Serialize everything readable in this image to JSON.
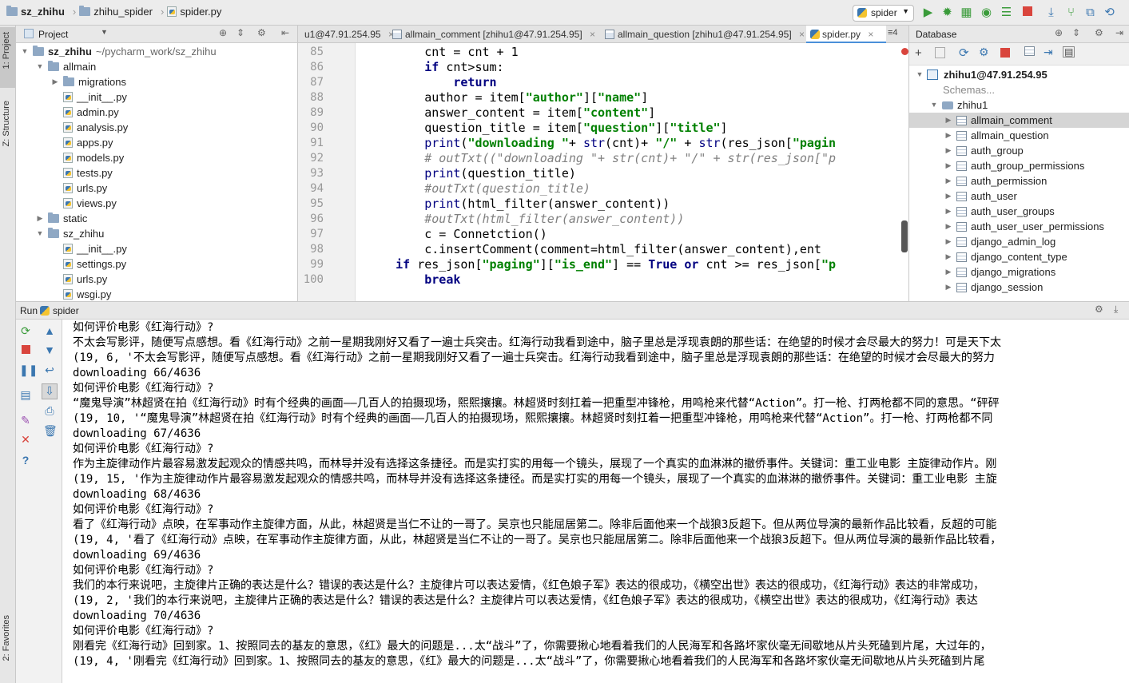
{
  "breadcrumb": [
    "sz_zhihu",
    "zhihu_spider",
    "spider.py"
  ],
  "run_config": "spider",
  "project_panel": {
    "title": "Project",
    "tree": [
      {
        "label": "sz_zhihu",
        "extra": "~/pycharm_work/sz_zhihu",
        "depth": 0,
        "type": "folder",
        "open": true
      },
      {
        "label": "allmain",
        "depth": 1,
        "type": "folder",
        "open": true
      },
      {
        "label": "migrations",
        "depth": 2,
        "type": "folder",
        "open": false
      },
      {
        "label": "__init__.py",
        "depth": 2,
        "type": "file"
      },
      {
        "label": "admin.py",
        "depth": 2,
        "type": "file"
      },
      {
        "label": "analysis.py",
        "depth": 2,
        "type": "file"
      },
      {
        "label": "apps.py",
        "depth": 2,
        "type": "file"
      },
      {
        "label": "models.py",
        "depth": 2,
        "type": "file"
      },
      {
        "label": "tests.py",
        "depth": 2,
        "type": "file"
      },
      {
        "label": "urls.py",
        "depth": 2,
        "type": "file"
      },
      {
        "label": "views.py",
        "depth": 2,
        "type": "file"
      },
      {
        "label": "static",
        "depth": 1,
        "type": "folder",
        "open": false
      },
      {
        "label": "sz_zhihu",
        "depth": 1,
        "type": "folder",
        "open": true
      },
      {
        "label": "__init__.py",
        "depth": 2,
        "type": "file"
      },
      {
        "label": "settings.py",
        "depth": 2,
        "type": "file"
      },
      {
        "label": "urls.py",
        "depth": 2,
        "type": "file"
      },
      {
        "label": "wsgi.py",
        "depth": 2,
        "type": "file"
      }
    ]
  },
  "side_labels": {
    "project": "1: Project",
    "structure": "Z: Structure",
    "favorites": "2: Favorites"
  },
  "editor_tabs": [
    {
      "label": "u1@47.91.254.95",
      "active": false
    },
    {
      "label": "allmain_comment [zhihu1@47.91.254.95]",
      "active": false
    },
    {
      "label": "allmain_question [zhihu1@47.91.254.95]",
      "active": false
    },
    {
      "label": "spider.py",
      "active": true
    }
  ],
  "tabs_overflow": "≡4",
  "code_lines": [
    {
      "n": "85",
      "text": "        cnt = cnt + 1"
    },
    {
      "n": "86",
      "text": "        if cnt>sum:"
    },
    {
      "n": "87",
      "text": "            return"
    },
    {
      "n": "88",
      "text": "        author = item[\"author\"][\"name\"]"
    },
    {
      "n": "89",
      "text": "        answer_content = item[\"content\"]"
    },
    {
      "n": "90",
      "text": "        question_title = item[\"question\"][\"title\"]"
    },
    {
      "n": "91",
      "text": "        print(\"downloading \"+ str(cnt)+ \"/\" + str(res_json[\"pagin"
    },
    {
      "n": "92",
      "text": "        # outTxt((\"downloading \"+ str(cnt)+ \"/\" + str(res_json[\"p"
    },
    {
      "n": "93",
      "text": "        print(question_title)"
    },
    {
      "n": "94",
      "text": "        #outTxt(question_title)"
    },
    {
      "n": "95",
      "text": "        print(html_filter(answer_content))"
    },
    {
      "n": "96",
      "text": "        #outTxt(html_filter(answer_content))"
    },
    {
      "n": "97",
      "text": "        c = Connetction()"
    },
    {
      "n": "98",
      "text": "        c.insertComment(comment=html_filter(answer_content),ent"
    },
    {
      "n": "99",
      "text": "    if res_json[\"paging\"][\"is_end\"] == True or cnt >= res_json[\"p"
    },
    {
      "n": "100",
      "text": "        break"
    }
  ],
  "database_panel": {
    "title": "Database",
    "root": "zhihu1@47.91.254.95",
    "schemas": "Schemas...",
    "db": "zhihu1",
    "tables": [
      "allmain_comment",
      "allmain_question",
      "auth_group",
      "auth_group_permissions",
      "auth_permission",
      "auth_user",
      "auth_user_groups",
      "auth_user_user_permissions",
      "django_admin_log",
      "django_content_type",
      "django_migrations",
      "django_session"
    ],
    "selected": "allmain_comment"
  },
  "run_panel": {
    "label": "Run",
    "config": "spider"
  },
  "console_lines": [
    "如何评价电影《红海行动》?",
    "不太会写影评，随便写点感想。看《红海行动》之前一星期我刚好又看了一遍士兵突击。红海行动我看到途中，脑子里总是浮现袁朗的那些话：在绝望的时候才会尽最大的努力！可是天下太",
    "(19, 6, '不太会写影评，随便写点感想。看《红海行动》之前一星期我刚好又看了一遍士兵突击。红海行动我看到途中，脑子里总是浮现袁朗的那些话：在绝望的时候才会尽最大的努力",
    "downloading 66/4636",
    "如何评价电影《红海行动》?",
    "“魔鬼导演”林超贤在拍《红海行动》时有个经典的画面——几百人的拍摄现场，熙熙攘攘。林超贤时刻扛着一把重型冲锋枪，用鸣枪来代替“Action”。打一枪、打两枪都不同的意思。“砰砰",
    "(19, 10, '“魔鬼导演”林超贤在拍《红海行动》时有个经典的画面——几百人的拍摄现场，熙熙攘攘。林超贤时刻扛着一把重型冲锋枪，用鸣枪来代替“Action”。打一枪、打两枪都不同",
    "downloading 67/4636",
    "如何评价电影《红海行动》?",
    "作为主旋律动作片最容易激发起观众的情感共鸣，而林导并没有选择这条捷径。而是实打实的用每一个镜头，展现了一个真实的血淋淋的撤侨事件。关键词：重工业电影 主旋律动作片。刚",
    "(19, 15, '作为主旋律动作片最容易激发起观众的情感共鸣，而林导并没有选择这条捷径。而是实打实的用每一个镜头，展现了一个真实的血淋淋的撤侨事件。关键词：重工业电影 主旋",
    "downloading 68/4636",
    "如何评价电影《红海行动》?",
    "看了《红海行动》点映，在军事动作主旋律方面，从此，林超贤是当仁不让的一哥了。吴京也只能屈居第二。除非后面他来一个战狼3反超下。但从两位导演的最新作品比较看，反超的可能",
    "(19, 4, '看了《红海行动》点映，在军事动作主旋律方面，从此，林超贤是当仁不让的一哥了。吴京也只能屈居第二。除非后面他来一个战狼3反超下。但从两位导演的最新作品比较看，",
    "downloading 69/4636",
    "如何评价电影《红海行动》?",
    "我们的本行来说吧，主旋律片正确的表达是什么？错误的表达是什么？主旋律片可以表达爱情，《红色娘子军》表达的很成功，《横空出世》表达的很成功，《红海行动》表达的非常成功，",
    "(19, 2, '我们的本行来说吧，主旋律片正确的表达是什么？错误的表达是什么？主旋律片可以表达爱情，《红色娘子军》表达的很成功，《横空出世》表达的很成功，《红海行动》表达",
    "downloading 70/4636",
    "如何评价电影《红海行动》?",
    "刚看完《红海行动》回到家。1、按照同去的基友的意思，《红》最大的问题是...太“战斗”了，你需要揪心地看着我们的人民海军和各路坏家伙毫无间歇地从片头死磕到片尾，大过年的，",
    "(19, 4, '刚看完《红海行动》回到家。1、按照同去的基友的意思，《红》最大的问题是...太“战斗”了，你需要揪心地看着我们的人民海军和各路坏家伙毫无间歇地从片头死磕到片尾"
  ]
}
